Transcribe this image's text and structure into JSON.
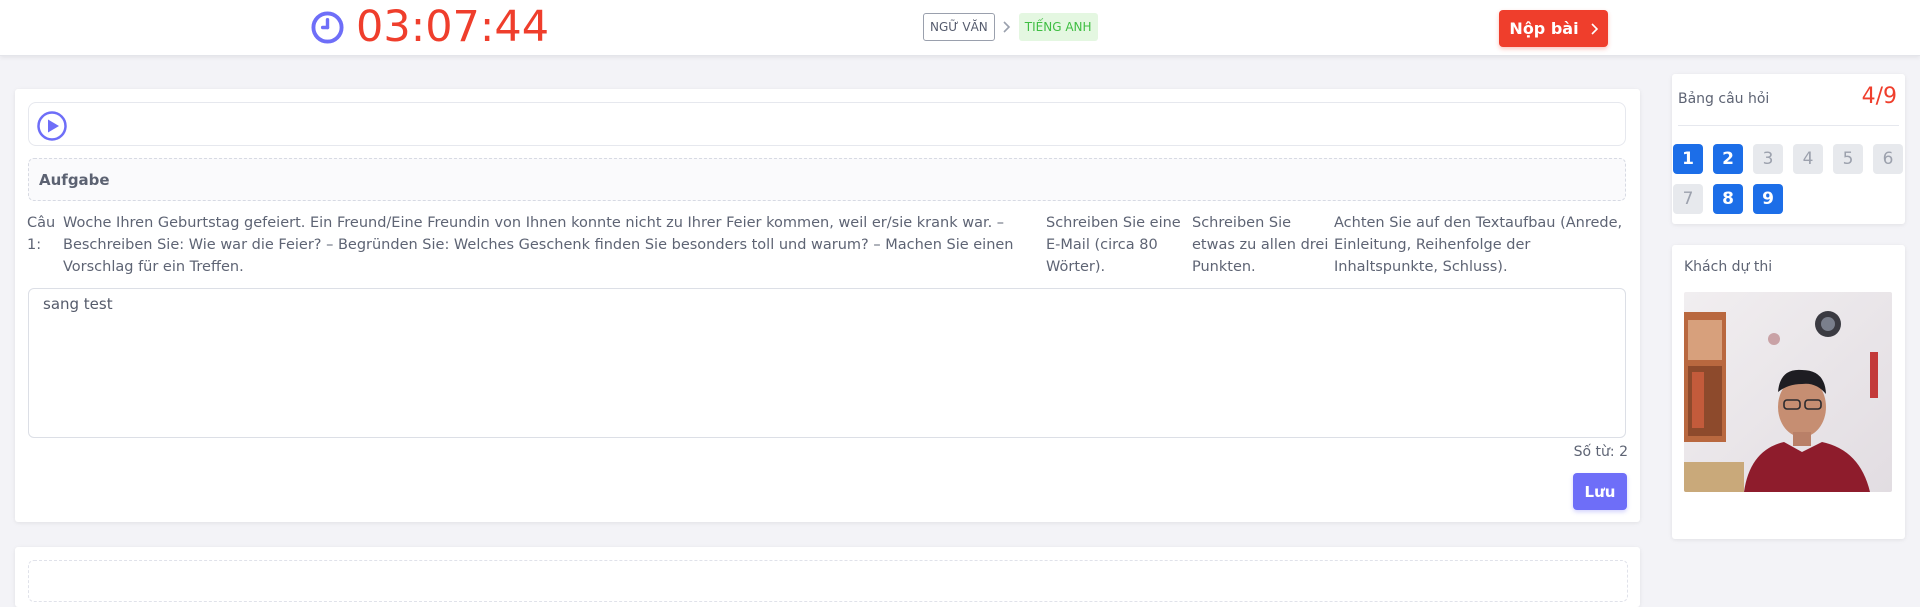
{
  "header": {
    "timer": "03:07:44",
    "breadcrumb": [
      "NGỮ VĂN",
      "TIẾNG ANH"
    ],
    "submit_label": "Nộp bài"
  },
  "main": {
    "section_title": "Aufgabe",
    "question": {
      "label": "Câu 1:",
      "columns": [
        "Woche Ihren Geburtstag gefeiert. Ein Freund/Eine Freundin von Ihnen konnte nicht zu Ihrer Feier kommen, weil er/sie krank war. – Beschreiben Sie: Wie war die Feier? – Begründen Sie: Welches Geschenk finden Sie besonders toll und warum? – Machen Sie einen Vorschlag für ein Treffen.",
        "Schreiben Sie eine E-Mail (circa 80 Wörter).",
        "Schreiben Sie etwas zu allen drei Punkten.",
        "Achten Sie auf den Textaufbau (Anrede, Einleitung, Reihenfolge der Inhaltspunkte, Schluss)."
      ]
    },
    "answer_value": "sang test",
    "word_count": "Số từ: 2",
    "save_label": "Lưu"
  },
  "question_board": {
    "title": "Bảng câu hỏi",
    "progress": "4/9",
    "questions": [
      {
        "num": "1",
        "done": true
      },
      {
        "num": "2",
        "done": true
      },
      {
        "num": "3",
        "done": false
      },
      {
        "num": "4",
        "done": false
      },
      {
        "num": "5",
        "done": false
      },
      {
        "num": "6",
        "done": false
      },
      {
        "num": "7",
        "done": false
      },
      {
        "num": "8",
        "done": true
      },
      {
        "num": "9",
        "done": true
      }
    ]
  },
  "candidate": {
    "title": "Khách dự thi"
  },
  "colors": {
    "accent_red": "#ef3e2c",
    "accent_purple": "#6e6ef8",
    "answered_blue": "#1c6ee8"
  }
}
